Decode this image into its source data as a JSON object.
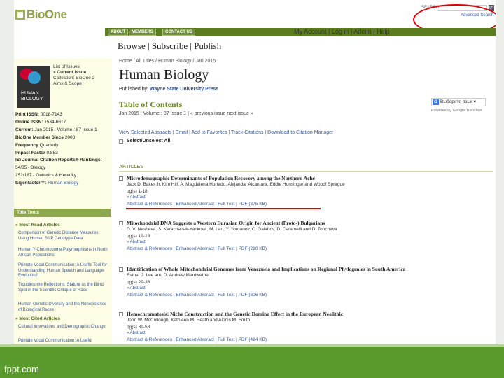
{
  "header": {
    "logo_text": "BioOne",
    "search_label": "SEARCH",
    "search_button": "go",
    "advanced_search": "Advanced Search"
  },
  "nav": {
    "about": "ABOUT",
    "members": "MEMBERS",
    "contact": "CONTACT US",
    "account": "My Account | Log in | Admin | Help"
  },
  "browse_bar": "Browse | Subscribe | Publish",
  "sidebar": {
    "cover_text": "HUMAN BIOLOGY",
    "links": [
      "List of Issues",
      "» Current Issue",
      "Collection: BioOne 2",
      "Aims & Scope"
    ],
    "issn": [
      {
        "label": "Print ISSN:",
        "value": "0018-7143"
      },
      {
        "label": "Online ISSN:",
        "value": "1534-6617"
      },
      {
        "label": "Current:",
        "value": "Jan 2015 : Volume : 87 Issue 1"
      },
      {
        "label": "BioOne Member Since",
        "value": "2008"
      },
      {
        "label": "Frequency",
        "value": "Quarterly"
      },
      {
        "label": "Impact Factor",
        "value": "0.853"
      },
      {
        "label": "ISI Journal Citation Reports® Rankings:",
        "value": ""
      },
      {
        "label": "",
        "value": "54/85 - Biology"
      },
      {
        "label": "",
        "value": "152/167 - Genetics & Heredity"
      },
      {
        "label": "Eigenfactor™:",
        "value": "Human Biology"
      }
    ],
    "tools_head": "Title Tools",
    "most_read_head": "» Most Read Articles",
    "most_read": [
      "Comparison of Genetic Distance Measures Using Human SNP Genotype Data",
      "Human Y-Chromosome Polymorphisms in North African Populations",
      "Primate Vocal Communication: A Useful Tool for Understanding Human Speech and Language Evolution?",
      "Troublesome Reflections: Stature as the Blind Spot in the Scientific Critique of Race",
      "Human Genetic Diversity and the Nonexistence of Biological Races"
    ],
    "most_cited_head": "» Most Cited Articles",
    "most_cited": [
      "Cultural Innovations and Demographic Change",
      "Primate Vocal Communication: A Useful"
    ]
  },
  "main": {
    "breadcrumb": "Home / All Titles / Human Biology / Jan 2015",
    "journal_title": "Human Biology",
    "publisher_label": "Published by:",
    "publisher": "Wayne State University Press",
    "toc_head": "Table of Contents",
    "issue_line": "Jan 2015 : Volume : 87 Issue 1  |  « previous issue next issue »",
    "translate": "Выберите язык",
    "powered": "Powered by Google Translate",
    "selection_actions": "View Selected Abstracts  |  Email  |  Add to Favorites  |  Track Citations  |  Download to Citation Manager",
    "select_all": "Select/Unselect All",
    "articles_head": "ARTICLES"
  },
  "articles": [
    {
      "title": "Microdemographic Determinants of Population Recovery among the Northern Aché",
      "authors": "Jack D. Baker Jr, Kim Hill, A. Magdalena Hurtado, Alejandar Alcantara, Eddie Hunsinger and Woodi Sprague",
      "pages": "pg(s) 1-18",
      "abstract": "» Abstract",
      "links": "Abstract & References  |  Enhanced Abstract  |  Full Text  |  PDF (375 KB)"
    },
    {
      "title": "Mitochondrial DNA Suggests a Western Eurasian Origin for Ancient (Proto-) Bulgarians",
      "authors": "D. V. Nesheva, S. Karachanak-Yankova, M. Lari, Y. Yordanov, C. Galabov, D. Caramelli and D. Toncheva",
      "pages": "pg(s) 19-28",
      "abstract": "» Abstract",
      "links": "Abstract & References  |  Enhanced Abstract  |  Full Text  |  PDF (210 KB)"
    },
    {
      "title": "Identification of Whole Mitochondrial Genomes from Venezuela and Implications on Regional Phylogenies in South America",
      "authors": "Esther J. Lee and D. Andrew Merriwether",
      "pages": "pg(s) 29-38",
      "abstract": "» Abstract",
      "links": "Abstract & References  |  Enhanced Abstract  |  Full Text  |  PDF (606 KB)"
    },
    {
      "title": "Hemochromatosis: Niche Construction and the Genetic Domino Effect in the European Neolithic",
      "authors": "John W. McCullough, Kathleen M. Heath and Alonis M. Smith",
      "pages": "pg(s) 39-58",
      "abstract": "» Abstract",
      "links": "Abstract & References  |  Enhanced Abstract  |  Full Text  |  PDF (494 KB)"
    }
  ],
  "footer": "fppt.com"
}
